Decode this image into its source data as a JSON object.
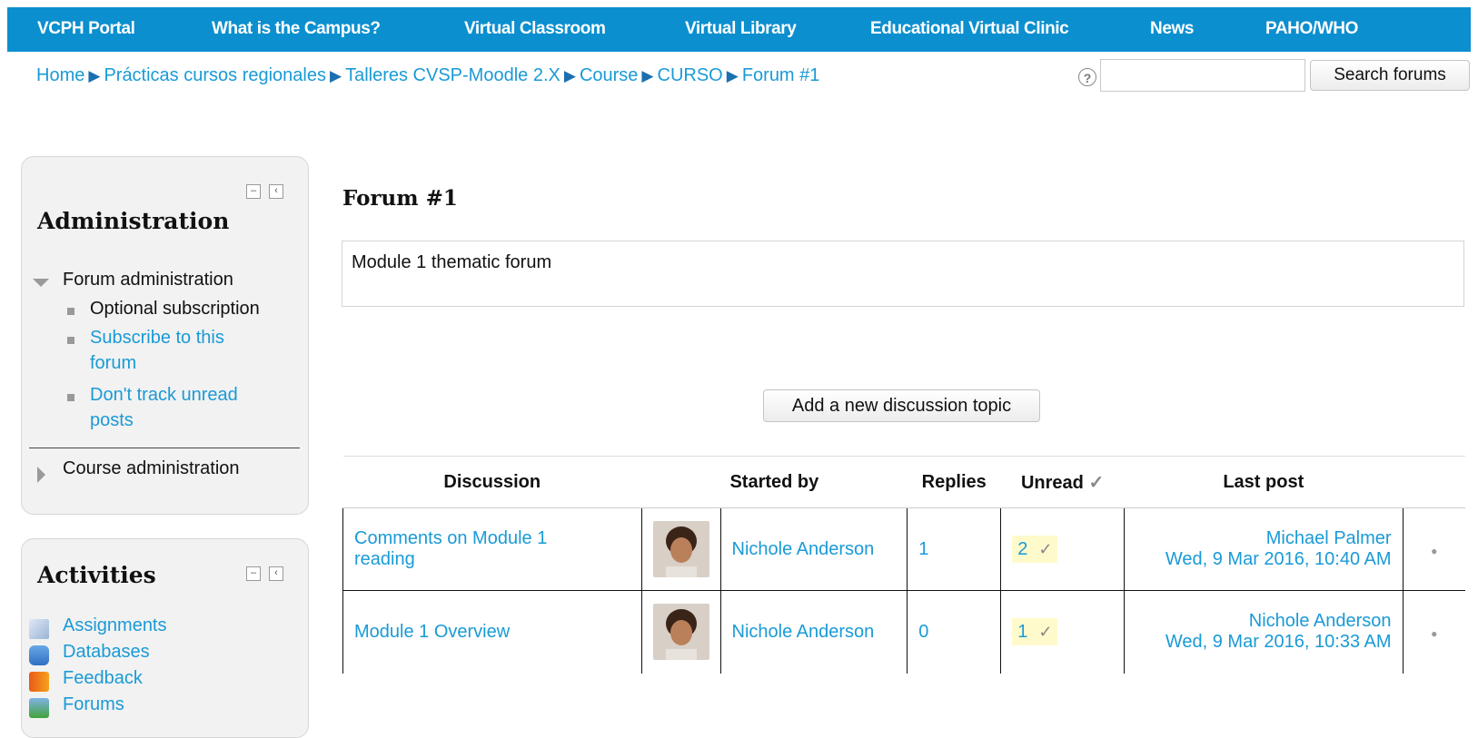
{
  "nav": {
    "items": [
      "VCPH Portal",
      "What is the Campus?",
      "Virtual Classroom",
      "Virtual Library",
      "Educational Virtual Clinic",
      "News",
      "PAHO/WHO"
    ]
  },
  "breadcrumb": [
    "Home",
    "Prácticas cursos regionales",
    "Talleres CVSP-Moodle 2.X",
    "Course",
    "CURSO",
    "Forum #1"
  ],
  "search": {
    "button_label": "Search forums",
    "value": ""
  },
  "administration": {
    "title": "Administration",
    "forum_admin_label": "Forum administration",
    "optional_subscription": "Optional subscription",
    "subscribe_line1": "Subscribe to this",
    "subscribe_line2": "forum",
    "dont_track_line1": "Don't track unread",
    "dont_track_line2": "posts",
    "course_admin_label": "Course administration"
  },
  "activities": {
    "title": "Activities",
    "items": [
      {
        "label": "Assignments",
        "icon": "assignment-icon"
      },
      {
        "label": "Databases",
        "icon": "database-icon"
      },
      {
        "label": "Feedback",
        "icon": "megaphone-icon"
      },
      {
        "label": "Forums",
        "icon": "forum-icon"
      }
    ]
  },
  "forum": {
    "title": "Forum #1",
    "intro": "Module 1 thematic forum",
    "add_topic_label": "Add a new discussion topic"
  },
  "table": {
    "headers": {
      "discussion": "Discussion",
      "started_by": "Started by",
      "replies": "Replies",
      "unread": "Unread",
      "last_post": "Last post"
    },
    "rows": [
      {
        "discussion_line1": "Comments on Module 1",
        "discussion_line2": "reading",
        "started_by": "Nichole Anderson",
        "replies": "1",
        "unread": "2",
        "last_post_author": "Michael Palmer",
        "last_post_date": "Wed, 9 Mar 2016, 10:40 AM"
      },
      {
        "discussion_line1": "Module 1 Overview",
        "discussion_line2": "",
        "started_by": "Nichole Anderson",
        "replies": "0",
        "unread": "1",
        "last_post_author": "Nichole Anderson",
        "last_post_date": "Wed, 9 Mar 2016, 10:33 AM"
      }
    ]
  },
  "colors": {
    "nav_bg": "#0c8fcf",
    "link": "#1a9ad6",
    "unread_highlight": "#fffacc"
  }
}
